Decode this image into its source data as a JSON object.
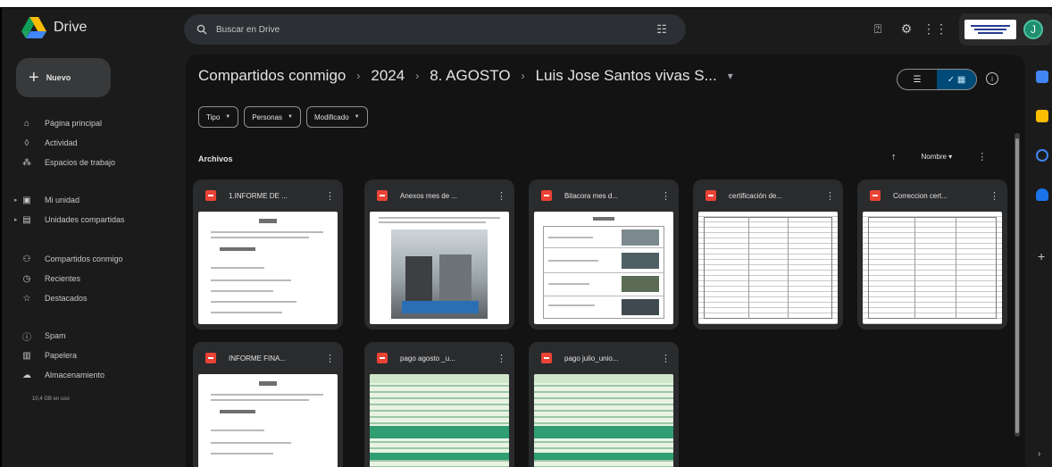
{
  "app": {
    "name": "Drive"
  },
  "search": {
    "placeholder": "Buscar en Drive"
  },
  "account": {
    "avatar_initial": "J"
  },
  "sidebar": {
    "new_label": "Nuevo",
    "items": [
      {
        "label": "Página principal",
        "icon": "home-icon"
      },
      {
        "label": "Actividad",
        "icon": "bell-icon"
      },
      {
        "label": "Espacios de trabajo",
        "icon": "workspaces-icon"
      },
      {
        "label": "Mi unidad",
        "icon": "my-drive-icon"
      },
      {
        "label": "Unidades compartidas",
        "icon": "shared-drives-icon"
      },
      {
        "label": "Compartidos conmigo",
        "icon": "shared-with-me-icon"
      },
      {
        "label": "Recientes",
        "icon": "clock-icon"
      },
      {
        "label": "Destacados",
        "icon": "star-icon"
      },
      {
        "label": "Spam",
        "icon": "spam-icon"
      },
      {
        "label": "Papelera",
        "icon": "trash-icon"
      },
      {
        "label": "Almacenamiento",
        "icon": "cloud-icon"
      }
    ],
    "storage_used": "10,4 GB en uso"
  },
  "breadcrumb": [
    "Compartidos conmigo",
    "2024",
    "8. AGOSTO",
    "Luis Jose Santos vivas S..."
  ],
  "filters": [
    {
      "label": "Tipo"
    },
    {
      "label": "Personas"
    },
    {
      "label": "Modificado"
    }
  ],
  "section": {
    "title": "Archivos"
  },
  "sort": {
    "label": "Nombre"
  },
  "files": [
    {
      "name": "1.INFORME DE ...",
      "thumb": "form"
    },
    {
      "name": "Anexos mes de ...",
      "thumb": "photo"
    },
    {
      "name": "Bitacora mes d...",
      "thumb": "table-photos"
    },
    {
      "name": "certificación de...",
      "thumb": "dense-form"
    },
    {
      "name": "Correccion cert...",
      "thumb": "dense-form"
    },
    {
      "name": "INFORME FINA...",
      "thumb": "form"
    },
    {
      "name": "pago agosto _u...",
      "thumb": "spreadsheet"
    },
    {
      "name": "pago julio_unio...",
      "thumb": "spreadsheet"
    }
  ],
  "colors": {
    "background": "#1b1b1b",
    "surface": "#131314",
    "card": "#2a2b2d",
    "pdf_red": "#ea4335",
    "toggle_active": "#004a77",
    "avatar": "#1e8e6e"
  }
}
